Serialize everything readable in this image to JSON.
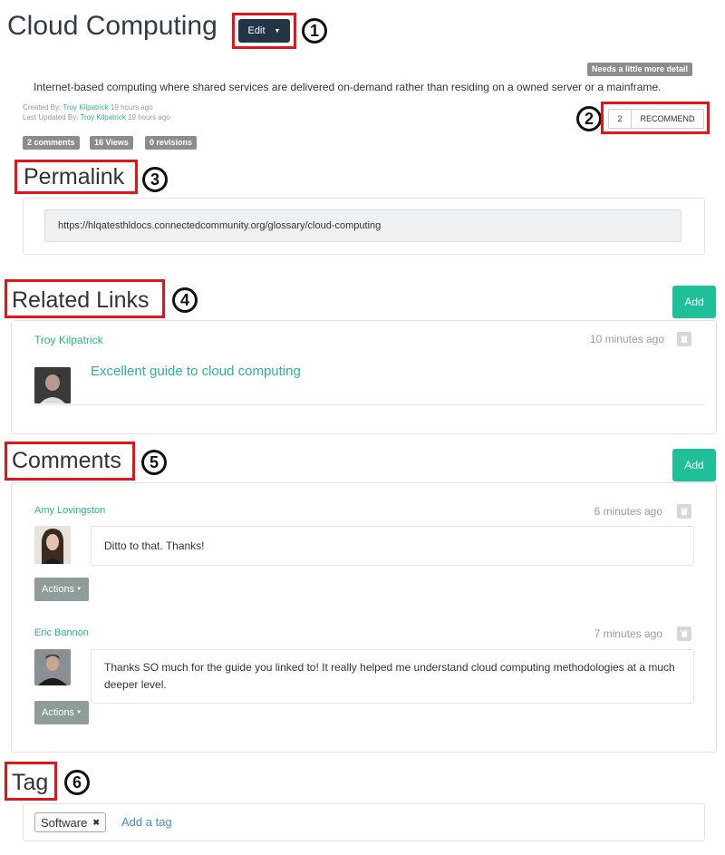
{
  "page": {
    "title": "Cloud Computing",
    "edit_label": "Edit",
    "quality_badge": "Needs a little more detail",
    "description": "Internet-based computing where shared services are delivered on-demand rather than residing on a owned server or a mainframe.",
    "created_prefix": "Created By:",
    "created_by": "Troy Kilpatrick",
    "created_ago": "19 hours ago",
    "updated_prefix": "Last Updated By:",
    "updated_by": "Troy Kilpatrick",
    "updated_ago": "19 hours ago",
    "stats": [
      "2 comments",
      "16 Views",
      "0 revisions"
    ],
    "recommend_count": "2",
    "recommend_label": "RECOMMEND"
  },
  "callouts": [
    "1",
    "2",
    "3",
    "4",
    "5",
    "6"
  ],
  "permalink": {
    "heading": "Permalink",
    "url": "https://hlqatesthldocs.connectedcommunity.org/glossary/cloud-computing"
  },
  "related_links": {
    "heading": "Related Links",
    "add_label": "Add",
    "items": [
      {
        "author": "Troy Kilpatrick",
        "time": "10 minutes ago",
        "title": "Excellent guide to cloud computing"
      }
    ]
  },
  "comments": {
    "heading": "Comments",
    "add_label": "Add",
    "items": [
      {
        "author": "Amy Lovingston",
        "time": "6 minutes ago",
        "text": "Ditto to that. Thanks!",
        "actions_label": "Actions"
      },
      {
        "author": "Eric Bannon",
        "time": "7 minutes ago",
        "text": "Thanks SO much for the guide you linked to! It really helped me understand cloud computing methodologies at a much deeper level.",
        "actions_label": "Actions"
      }
    ]
  },
  "tags": {
    "heading": "Tag",
    "items": [
      "Software"
    ],
    "add_tag_label": "Add a tag"
  },
  "colors": {
    "accent": "#1fbf9a",
    "link": "#2ab38f",
    "callout_box": "#e4141b",
    "edit_button": "#243447"
  }
}
